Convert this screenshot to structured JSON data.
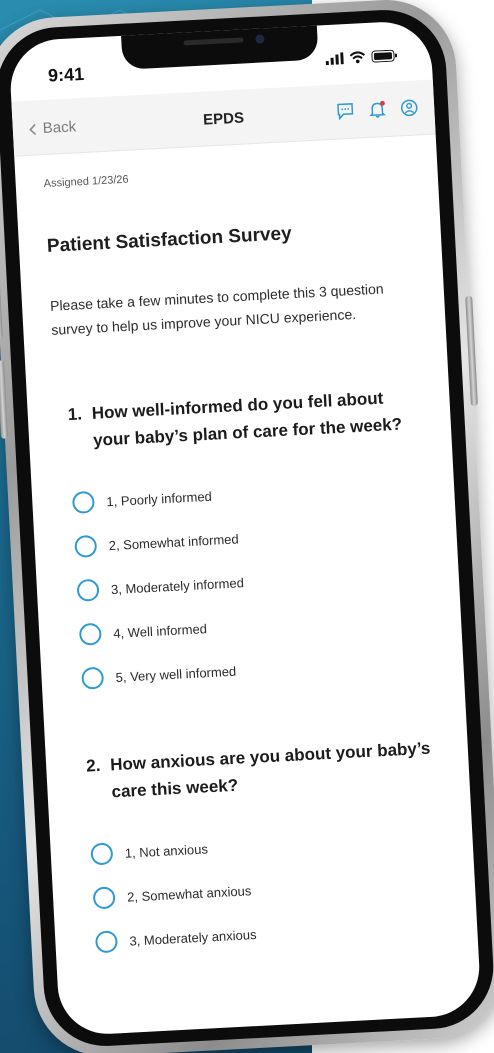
{
  "status_bar": {
    "time": "9:41"
  },
  "nav": {
    "back_label": "Back",
    "title": "EPDS"
  },
  "content": {
    "assigned": "Assigned 1/23/26",
    "survey_title": "Patient Satisfaction Survey",
    "intro": "Please take a few minutes to complete this 3 question survey to help us improve your NICU experience."
  },
  "questions": [
    {
      "number": "1.",
      "line1": "How well-informed do you fell about",
      "line2": "your baby’s plan of care for the week?",
      "options": [
        "1, Poorly informed",
        "2, Somewhat informed",
        "3, Moderately informed",
        "4, Well informed",
        "5, Very well informed"
      ]
    },
    {
      "number": "2.",
      "line1": "How anxious are you about your baby’s",
      "line2": "care this week?",
      "options": [
        "1, Not anxious",
        "2, Somewhat anxious",
        "3, Moderately anxious"
      ]
    }
  ],
  "colors": {
    "accent": "#2e9ad4",
    "background": "#1d6e92",
    "notification_dot": "#e53935"
  },
  "icons": {
    "back": "chevron-left-icon",
    "chat": "chat-icon",
    "bell": "bell-icon",
    "profile": "profile-icon",
    "signal": "signal-icon",
    "wifi": "wifi-icon",
    "battery": "battery-icon"
  }
}
